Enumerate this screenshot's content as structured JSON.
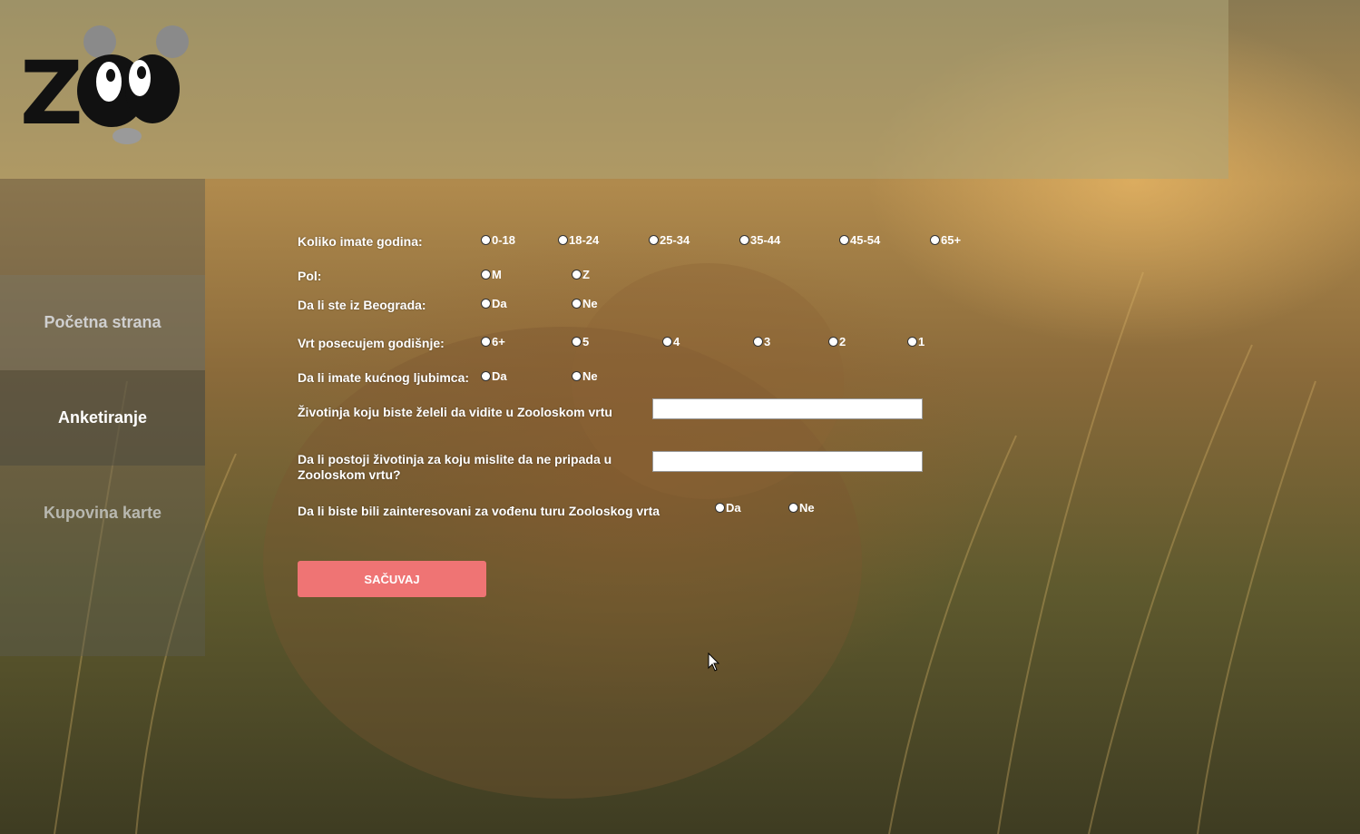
{
  "logo": {
    "text": "ZOO"
  },
  "nav": {
    "items": [
      {
        "label": "Početna strana"
      },
      {
        "label": "Anketiranje"
      },
      {
        "label": "Kupovina karte"
      }
    ]
  },
  "form": {
    "age": {
      "label": "Koliko imate godina:",
      "options": [
        "0-18",
        "18-24",
        "25-34",
        "35-44",
        "45-54",
        "65+"
      ]
    },
    "gender": {
      "label": "Pol:",
      "options": [
        "M",
        "Z"
      ]
    },
    "belgrade": {
      "label": "Da li ste iz Beograda:",
      "options": [
        "Da",
        "Ne"
      ]
    },
    "visits": {
      "label": "Vrt posecujem godišnje:",
      "options": [
        "6+",
        "5",
        "4",
        "3",
        "2",
        "1"
      ]
    },
    "pet": {
      "label": "Da li imate kućnog ljubimca:",
      "options": [
        "Da",
        "Ne"
      ]
    },
    "wish_animal": {
      "label": "Životinja koju biste želeli da vidite u Zooloskom vrtu",
      "value": ""
    },
    "unwanted_animal": {
      "label_line1": "Da li postoji životinja za koju mislite da ne pripada u",
      "label_line2": "Zooloskom vrtu?",
      "value": ""
    },
    "tour": {
      "label": "Da li biste bili zainteresovani za vođenu turu Zooloskog vrta",
      "options": [
        "Da",
        "Ne"
      ]
    },
    "save_label": "SAČUVAJ"
  },
  "colors": {
    "accent": "#ef7474"
  }
}
